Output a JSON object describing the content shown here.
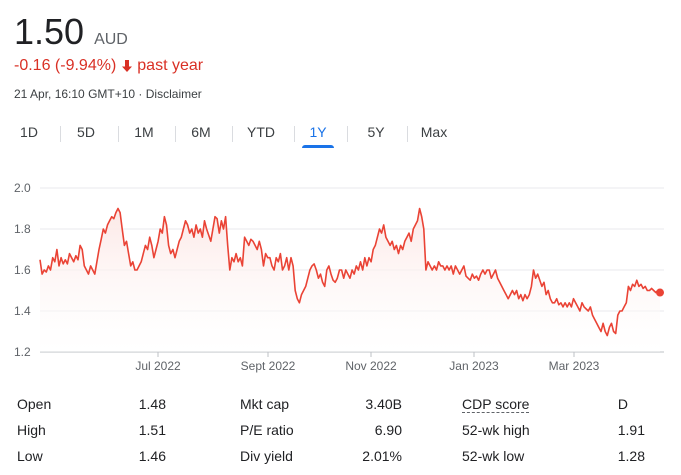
{
  "quote": {
    "price": "1.50",
    "currency": "AUD",
    "change": "-0.16 (-9.94%)",
    "period": "past year",
    "timestamp": "21 Apr, 16:10 GMT+10",
    "separator": "·",
    "disclaimer": "Disclaimer",
    "change_color": "#d93025"
  },
  "tabs": [
    {
      "label": "1D",
      "active": false
    },
    {
      "label": "5D",
      "active": false
    },
    {
      "label": "1M",
      "active": false
    },
    {
      "label": "6M",
      "active": false
    },
    {
      "label": "YTD",
      "active": false
    },
    {
      "label": "1Y",
      "active": true
    },
    {
      "label": "5Y",
      "active": false
    },
    {
      "label": "Max",
      "active": false
    }
  ],
  "chart_data": {
    "type": "area",
    "y_ticks": [
      "2.0",
      "1.8",
      "1.6",
      "1.4",
      "1.2"
    ],
    "ylim": [
      1.2,
      2.0
    ],
    "x_ticks": [
      "Jul 2022",
      "Sept 2022",
      "Nov 2022",
      "Jan 2023",
      "Mar 2023"
    ],
    "grid": true,
    "line_color": "#ea4335",
    "fill_color": "#fce8e6",
    "values": [
      1.65,
      1.58,
      1.6,
      1.59,
      1.62,
      1.6,
      1.66,
      1.64,
      1.7,
      1.62,
      1.66,
      1.63,
      1.65,
      1.63,
      1.68,
      1.66,
      1.64,
      1.67,
      1.65,
      1.72,
      1.7,
      1.62,
      1.6,
      1.58,
      1.62,
      1.6,
      1.58,
      1.64,
      1.7,
      1.75,
      1.8,
      1.78,
      1.82,
      1.84,
      1.86,
      1.85,
      1.88,
      1.9,
      1.88,
      1.8,
      1.72,
      1.74,
      1.68,
      1.62,
      1.64,
      1.6,
      1.6,
      1.62,
      1.64,
      1.68,
      1.72,
      1.7,
      1.76,
      1.72,
      1.66,
      1.7,
      1.74,
      1.8,
      1.78,
      1.86,
      1.82,
      1.72,
      1.68,
      1.7,
      1.66,
      1.7,
      1.74,
      1.76,
      1.8,
      1.84,
      1.82,
      1.78,
      1.8,
      1.76,
      1.82,
      1.78,
      1.8,
      1.76,
      1.84,
      1.8,
      1.77,
      1.74,
      1.8,
      1.86,
      1.85,
      1.78,
      1.84,
      1.8,
      1.86,
      1.72,
      1.6,
      1.66,
      1.64,
      1.68,
      1.64,
      1.66,
      1.62,
      1.76,
      1.74,
      1.72,
      1.75,
      1.74,
      1.72,
      1.7,
      1.74,
      1.7,
      1.62,
      1.68,
      1.66,
      1.66,
      1.62,
      1.6,
      1.66,
      1.64,
      1.68,
      1.6,
      1.62,
      1.66,
      1.6,
      1.66,
      1.62,
      1.5,
      1.46,
      1.44,
      1.48,
      1.5,
      1.52,
      1.56,
      1.6,
      1.62,
      1.63,
      1.6,
      1.56,
      1.58,
      1.54,
      1.52,
      1.6,
      1.62,
      1.58,
      1.55,
      1.54,
      1.56,
      1.6,
      1.6,
      1.56,
      1.6,
      1.58,
      1.56,
      1.6,
      1.58,
      1.62,
      1.6,
      1.64,
      1.6,
      1.66,
      1.62,
      1.66,
      1.64,
      1.7,
      1.72,
      1.76,
      1.8,
      1.78,
      1.82,
      1.76,
      1.74,
      1.72,
      1.74,
      1.7,
      1.72,
      1.68,
      1.72,
      1.7,
      1.74,
      1.76,
      1.78,
      1.74,
      1.8,
      1.82,
      1.84,
      1.9,
      1.86,
      1.8,
      1.6,
      1.64,
      1.62,
      1.6,
      1.62,
      1.6,
      1.64,
      1.62,
      1.62,
      1.6,
      1.62,
      1.6,
      1.62,
      1.58,
      1.62,
      1.6,
      1.58,
      1.6,
      1.62,
      1.57,
      1.56,
      1.55,
      1.58,
      1.56,
      1.57,
      1.55,
      1.58,
      1.6,
      1.58,
      1.6,
      1.6,
      1.56,
      1.58,
      1.6,
      1.56,
      1.54,
      1.52,
      1.5,
      1.48,
      1.46,
      1.48,
      1.5,
      1.48,
      1.5,
      1.46,
      1.48,
      1.45,
      1.48,
      1.46,
      1.48,
      1.52,
      1.6,
      1.56,
      1.58,
      1.55,
      1.52,
      1.54,
      1.48,
      1.5,
      1.46,
      1.44,
      1.44,
      1.46,
      1.43,
      1.44,
      1.42,
      1.44,
      1.42,
      1.44,
      1.42,
      1.46,
      1.44,
      1.42,
      1.4,
      1.44,
      1.42,
      1.41,
      1.4,
      1.42,
      1.38,
      1.36,
      1.34,
      1.32,
      1.3,
      1.34,
      1.3,
      1.28,
      1.32,
      1.34,
      1.3,
      1.29,
      1.38,
      1.4,
      1.4,
      1.42,
      1.44,
      1.52,
      1.5,
      1.53,
      1.52,
      1.55,
      1.52,
      1.53,
      1.51,
      1.52,
      1.5,
      1.5,
      1.51,
      1.5,
      1.49,
      1.5,
      1.49
    ]
  },
  "stats": [
    {
      "label": "Open",
      "value": "1.48"
    },
    {
      "label": "High",
      "value": "1.51"
    },
    {
      "label": "Low",
      "value": "1.46"
    },
    {
      "label": "Mkt cap",
      "value": "3.40B"
    },
    {
      "label": "P/E ratio",
      "value": "6.90"
    },
    {
      "label": "Div yield",
      "value": "2.01%"
    },
    {
      "label": "CDP score",
      "value": "D"
    },
    {
      "label": "52-wk high",
      "value": "1.91"
    },
    {
      "label": "52-wk low",
      "value": "1.28"
    }
  ]
}
